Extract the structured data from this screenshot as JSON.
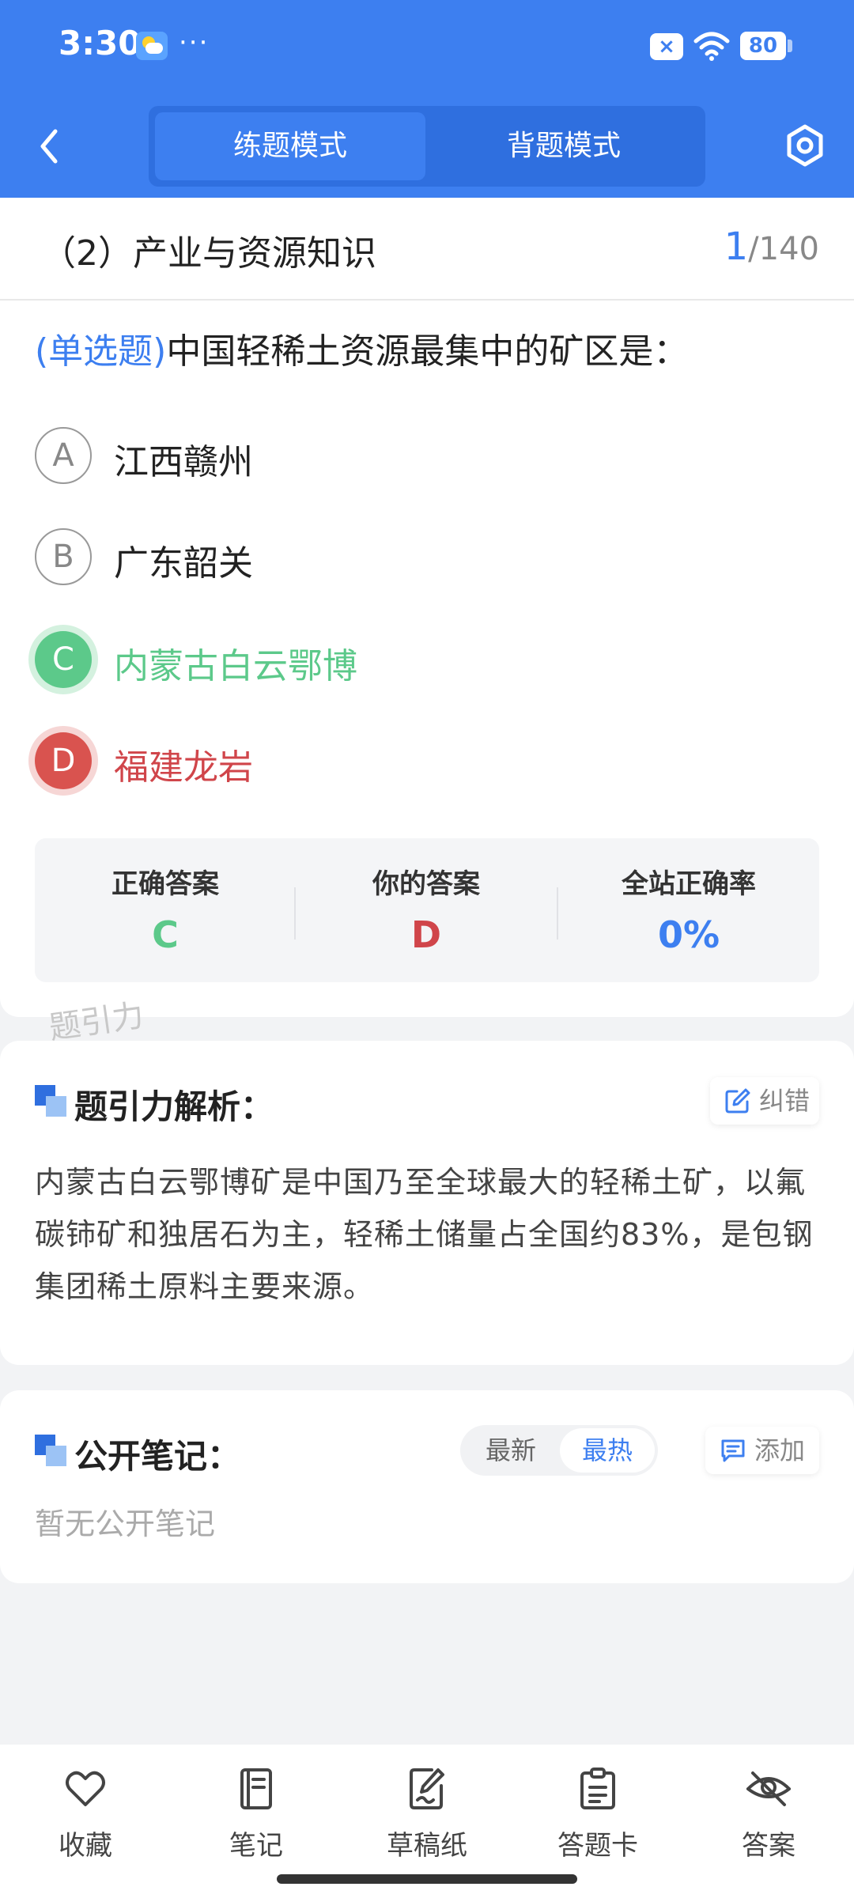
{
  "status_bar": {
    "time": "3:30",
    "more": "···",
    "battery": "80"
  },
  "header": {
    "tabs": [
      "练题模式",
      "背题模式"
    ]
  },
  "question": {
    "section": "（2）产业与资源知识",
    "progress_current": "1",
    "progress_total": "/140",
    "type_label": "(单选题)",
    "text": "中国轻稀土资源最集中的矿区是：",
    "options": [
      {
        "letter": "A",
        "text": "江西赣州",
        "state": "normal"
      },
      {
        "letter": "B",
        "text": "广东韶关",
        "state": "normal"
      },
      {
        "letter": "C",
        "text": "内蒙古白云鄂博",
        "state": "correct"
      },
      {
        "letter": "D",
        "text": "福建龙岩",
        "state": "wrong"
      }
    ]
  },
  "answer_summary": {
    "correct_label": "正确答案",
    "correct_value": "C",
    "mine_label": "你的答案",
    "mine_value": "D",
    "rate_label": "全站正确率",
    "rate_value": "0%"
  },
  "watermark": "题引力",
  "analysis": {
    "title": "题引力解析：",
    "report_btn": "纠错",
    "body": "内蒙古白云鄂博矿是中国乃至全球最大的轻稀土矿，以氟碳铈矿和独居石为主，轻稀土储量占全国约83%，是包钢集团稀土原料主要来源。"
  },
  "notes": {
    "title": "公开笔记：",
    "sort_options": [
      "最新",
      "最热"
    ],
    "active_sort": "最热",
    "add_btn": "添加",
    "empty": "暂无公开笔记"
  },
  "bottom_nav": [
    "收藏",
    "笔记",
    "草稿纸",
    "答题卡",
    "答案"
  ],
  "colors": {
    "primary": "#3d7ff0",
    "correct": "#5cc98a",
    "wrong": "#d0454a"
  }
}
